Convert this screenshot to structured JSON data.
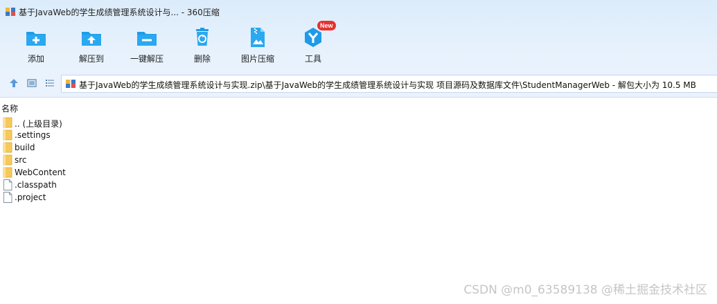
{
  "window": {
    "title": "基于JavaWeb的学生成绩管理系统设计与... - 360压缩"
  },
  "toolbar": {
    "items": [
      {
        "label": "添加",
        "icon": "add-icon"
      },
      {
        "label": "解压到",
        "icon": "extract-to-icon"
      },
      {
        "label": "一键解压",
        "icon": "one-click-extract-icon"
      },
      {
        "label": "删除",
        "icon": "delete-icon"
      },
      {
        "label": "图片压缩",
        "icon": "image-compress-icon"
      },
      {
        "label": "工具",
        "icon": "tools-icon",
        "badge": "New"
      }
    ]
  },
  "navbar": {
    "buttons": [
      "up-icon",
      "view-thumbnail-icon",
      "view-list-icon"
    ],
    "path": "基于JavaWeb的学生成绩管理系统设计与实现.zip\\基于JavaWeb的学生成绩管理系统设计与实现 项目源码及数据库文件\\StudentManagerWeb - 解包大小为 10.5 MB"
  },
  "list": {
    "header": "名称",
    "rows": [
      {
        "name": ".. (上级目录)",
        "type": "folder"
      },
      {
        "name": ".settings",
        "type": "folder"
      },
      {
        "name": "build",
        "type": "folder"
      },
      {
        "name": "src",
        "type": "folder"
      },
      {
        "name": "WebContent",
        "type": "folder"
      },
      {
        "name": ".classpath",
        "type": "file"
      },
      {
        "name": ".project",
        "type": "file"
      }
    ]
  },
  "watermark": "CSDN @m0_63589138 @稀土掘金技术社区",
  "colors": {
    "accent": "#1e9be8",
    "folder": "#f6c95a",
    "badge": "#e8322e"
  }
}
